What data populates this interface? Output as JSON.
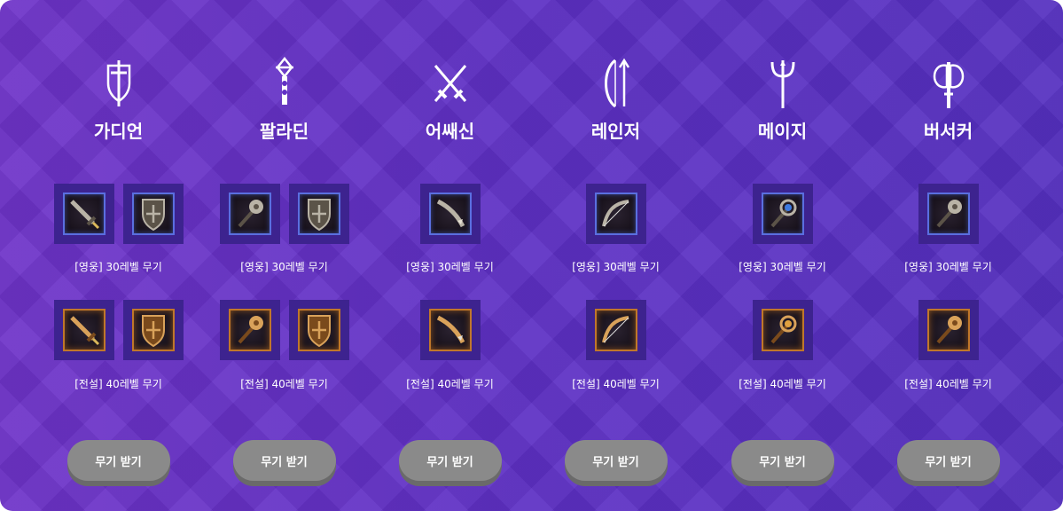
{
  "classes": [
    {
      "name": "가디언",
      "icon": "sword-shield-icon",
      "hero_items": [
        "longsword-icon",
        "shield-icon"
      ],
      "legend_items": [
        "greatsword-icon",
        "round-shield-icon"
      ]
    },
    {
      "name": "팔라딘",
      "icon": "holy-cross-icon",
      "hero_items": [
        "mace-icon",
        "shield-icon"
      ],
      "legend_items": [
        "mace-icon",
        "round-shield-icon"
      ]
    },
    {
      "name": "어쌔신",
      "icon": "crossed-daggers-icon",
      "hero_items": [
        "claw-blade-icon"
      ],
      "legend_items": [
        "serrated-blade-icon"
      ]
    },
    {
      "name": "레인저",
      "icon": "bow-arrow-icon",
      "hero_items": [
        "bow-icon"
      ],
      "legend_items": [
        "longbow-icon"
      ]
    },
    {
      "name": "메이지",
      "icon": "trident-staff-icon",
      "hero_items": [
        "orb-staff-icon"
      ],
      "legend_items": [
        "crystal-staff-icon"
      ]
    },
    {
      "name": "버서커",
      "icon": "battle-axe-icon",
      "hero_items": [
        "spiked-club-icon"
      ],
      "legend_items": [
        "war-hammer-icon"
      ]
    }
  ],
  "labels": {
    "hero": "[영웅] 30레벨 무기",
    "legend": "[전설] 40레벨 무기",
    "button": "무기 받기"
  },
  "colors": {
    "background": "#6030c4",
    "slot": "#3d238f",
    "hero_frame": "#5a6fe0",
    "legend_frame": "#c0772a",
    "button": "#8a8a8a"
  }
}
